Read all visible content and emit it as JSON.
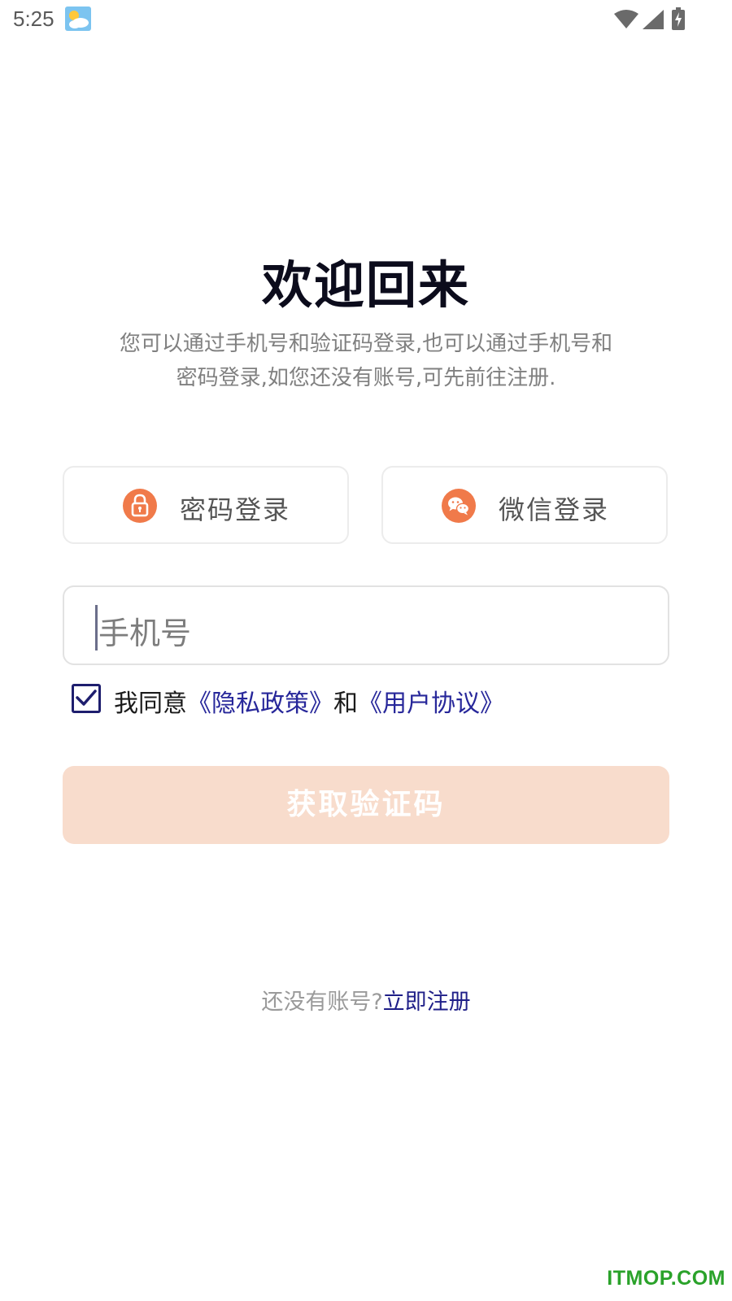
{
  "status_bar": {
    "time": "5:25",
    "weather_icon": "partly-cloudy-icon",
    "wifi_icon": "wifi-icon",
    "signal_icon": "cell-signal-icon",
    "battery_icon": "battery-charging-icon"
  },
  "header": {
    "title": "欢迎回来",
    "subtitle_line1": "您可以通过手机号和验证码登录,也可以通过手机号和",
    "subtitle_line2": "密码登录,如您还没有账号,可先前往注册."
  },
  "login_methods": [
    {
      "label": "密码登录",
      "icon": "lock-icon"
    },
    {
      "label": "微信登录",
      "icon": "wechat-icon"
    }
  ],
  "phone_input": {
    "placeholder": "手机号",
    "value": ""
  },
  "agreement": {
    "checked": true,
    "prefix": "我同意",
    "privacy_link": "《隐私政策》",
    "conjunction": "和",
    "terms_link": "《用户协议》"
  },
  "primary_button": {
    "label": "获取验证码",
    "enabled": false
  },
  "register": {
    "prompt": "还没有账号?",
    "link": "立即注册"
  },
  "watermark": "ITMOP.COM",
  "colors": {
    "accent": "#f07a4a",
    "button_disabled": "#f8dccc",
    "link": "#27279a",
    "title": "#0c0c1c"
  }
}
